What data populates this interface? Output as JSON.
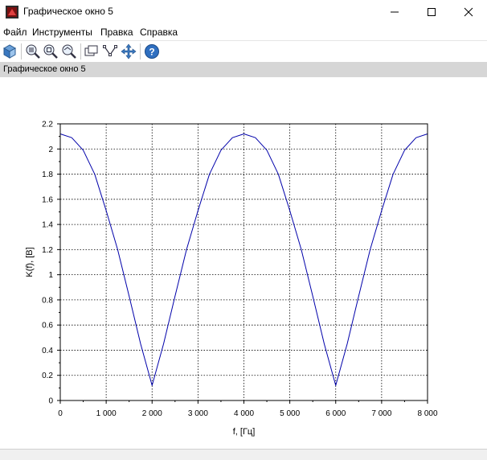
{
  "window": {
    "title": "Графическое окно 5",
    "controls": [
      "minimize",
      "maximize",
      "close"
    ]
  },
  "menu": {
    "items": [
      {
        "label": "Файл"
      },
      {
        "label": "Инструменты"
      },
      {
        "label": "Правка"
      },
      {
        "label": "Справка"
      }
    ]
  },
  "toolbar": {
    "icons": [
      "rotate-icon",
      "zoom-in-icon",
      "zoom-rect-icon",
      "zoom-out-icon",
      "datatip-icon",
      "edit-data-icon",
      "pan-icon",
      "help-icon"
    ]
  },
  "info_bar": {
    "text": "Графическое окно 5"
  },
  "chart_data": {
    "type": "line",
    "title": "",
    "xlabel": "f, [Гц]",
    "ylabel": "K(f), [B]",
    "xlim": [
      0,
      8000
    ],
    "ylim": [
      0,
      2.2
    ],
    "xticks": [
      0,
      1000,
      2000,
      3000,
      4000,
      5000,
      6000,
      7000,
      8000
    ],
    "xtick_labels": [
      "0",
      "1 000",
      "2 000",
      "3 000",
      "4 000",
      "5 000",
      "6 000",
      "7 000",
      "8 000"
    ],
    "yticks": [
      0,
      0.2,
      0.4,
      0.6,
      0.8,
      1,
      1.2,
      1.4,
      1.6,
      1.8,
      2,
      2.2
    ],
    "ytick_labels": [
      "0",
      "0.2",
      "0.4",
      "0.6",
      "0.8",
      "1",
      "1.2",
      "1.4",
      "1.6",
      "1.8",
      "2",
      "2.2"
    ],
    "grid": true,
    "series": [
      {
        "color": "#0000aa",
        "x": [
          0,
          250,
          500,
          750,
          1000,
          1250,
          1500,
          1750,
          2000,
          2250,
          2500,
          2750,
          3000,
          3250,
          3500,
          3750,
          4000,
          4250,
          4500,
          4750,
          5000,
          5250,
          5500,
          5750,
          6000,
          6250,
          6500,
          6750,
          7000,
          7250,
          7500,
          7750,
          8000
        ],
        "y": [
          2.12,
          2.09,
          1.99,
          1.8,
          1.51,
          1.2,
          0.83,
          0.45,
          0.12,
          0.45,
          0.83,
          1.2,
          1.51,
          1.8,
          1.99,
          2.09,
          2.12,
          2.09,
          1.99,
          1.8,
          1.51,
          1.2,
          0.83,
          0.45,
          0.12,
          0.45,
          0.83,
          1.2,
          1.51,
          1.8,
          1.99,
          2.09,
          2.12
        ]
      }
    ]
  }
}
